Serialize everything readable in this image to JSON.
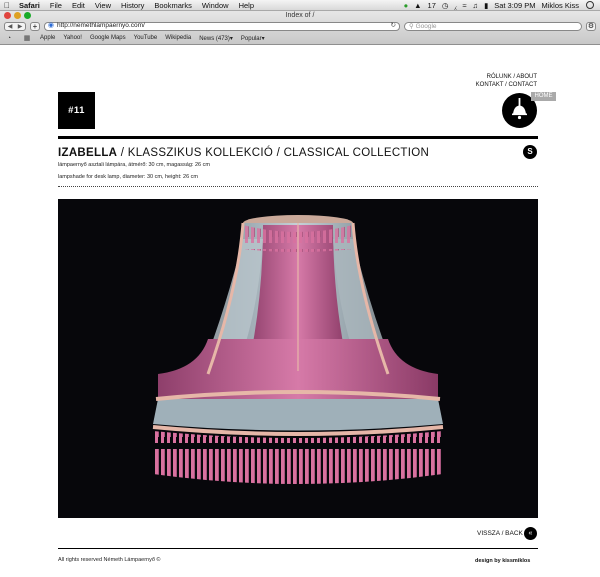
{
  "menubar": {
    "app": "Safari",
    "items": [
      "File",
      "Edit",
      "View",
      "History",
      "Bookmarks",
      "Window",
      "Help"
    ],
    "status_count": "17",
    "clock": "Sat 3:09 PM",
    "user": "Miklos Kiss"
  },
  "browser": {
    "window_title": "Index of /",
    "url": "http://nemethlampaernyo.com/",
    "search_placeholder": "Google",
    "bookmarks": [
      "Apple",
      "Yahoo!",
      "Google Maps",
      "YouTube",
      "Wikipedia",
      "News (473)▾",
      "Popular▾"
    ]
  },
  "page": {
    "logo_text": "#11",
    "nav_line1": "RÓLUNK / ABOUT",
    "nav_line2": "KONTAKT / CONTACT",
    "home_label": "HOME",
    "title_bold": "IZABELLA",
    "title_rest": " / KLASSZIKUS KOLLEKCIÓ / CLASSICAL COLLECTION",
    "badge_letter": "S",
    "desc_hu": "lámpaernyő asztali lámpára, átmérő: 30 cm, magasság: 26 cm",
    "desc_en": "lampshade for desk lamp, diameter: 30 cm, height: 26 cm",
    "back_label": "VISSZA / BACK",
    "back_icon": "«",
    "footer_left": "All rights reserved Németh Lámpaernyő ©",
    "footer_right": "design by kissmiklos"
  },
  "colors": {
    "shade_pink": "#c96a9c",
    "shade_light": "#b9c6cd",
    "fringe_pink": "#e48ab6",
    "photo_bg": "#07070b"
  }
}
